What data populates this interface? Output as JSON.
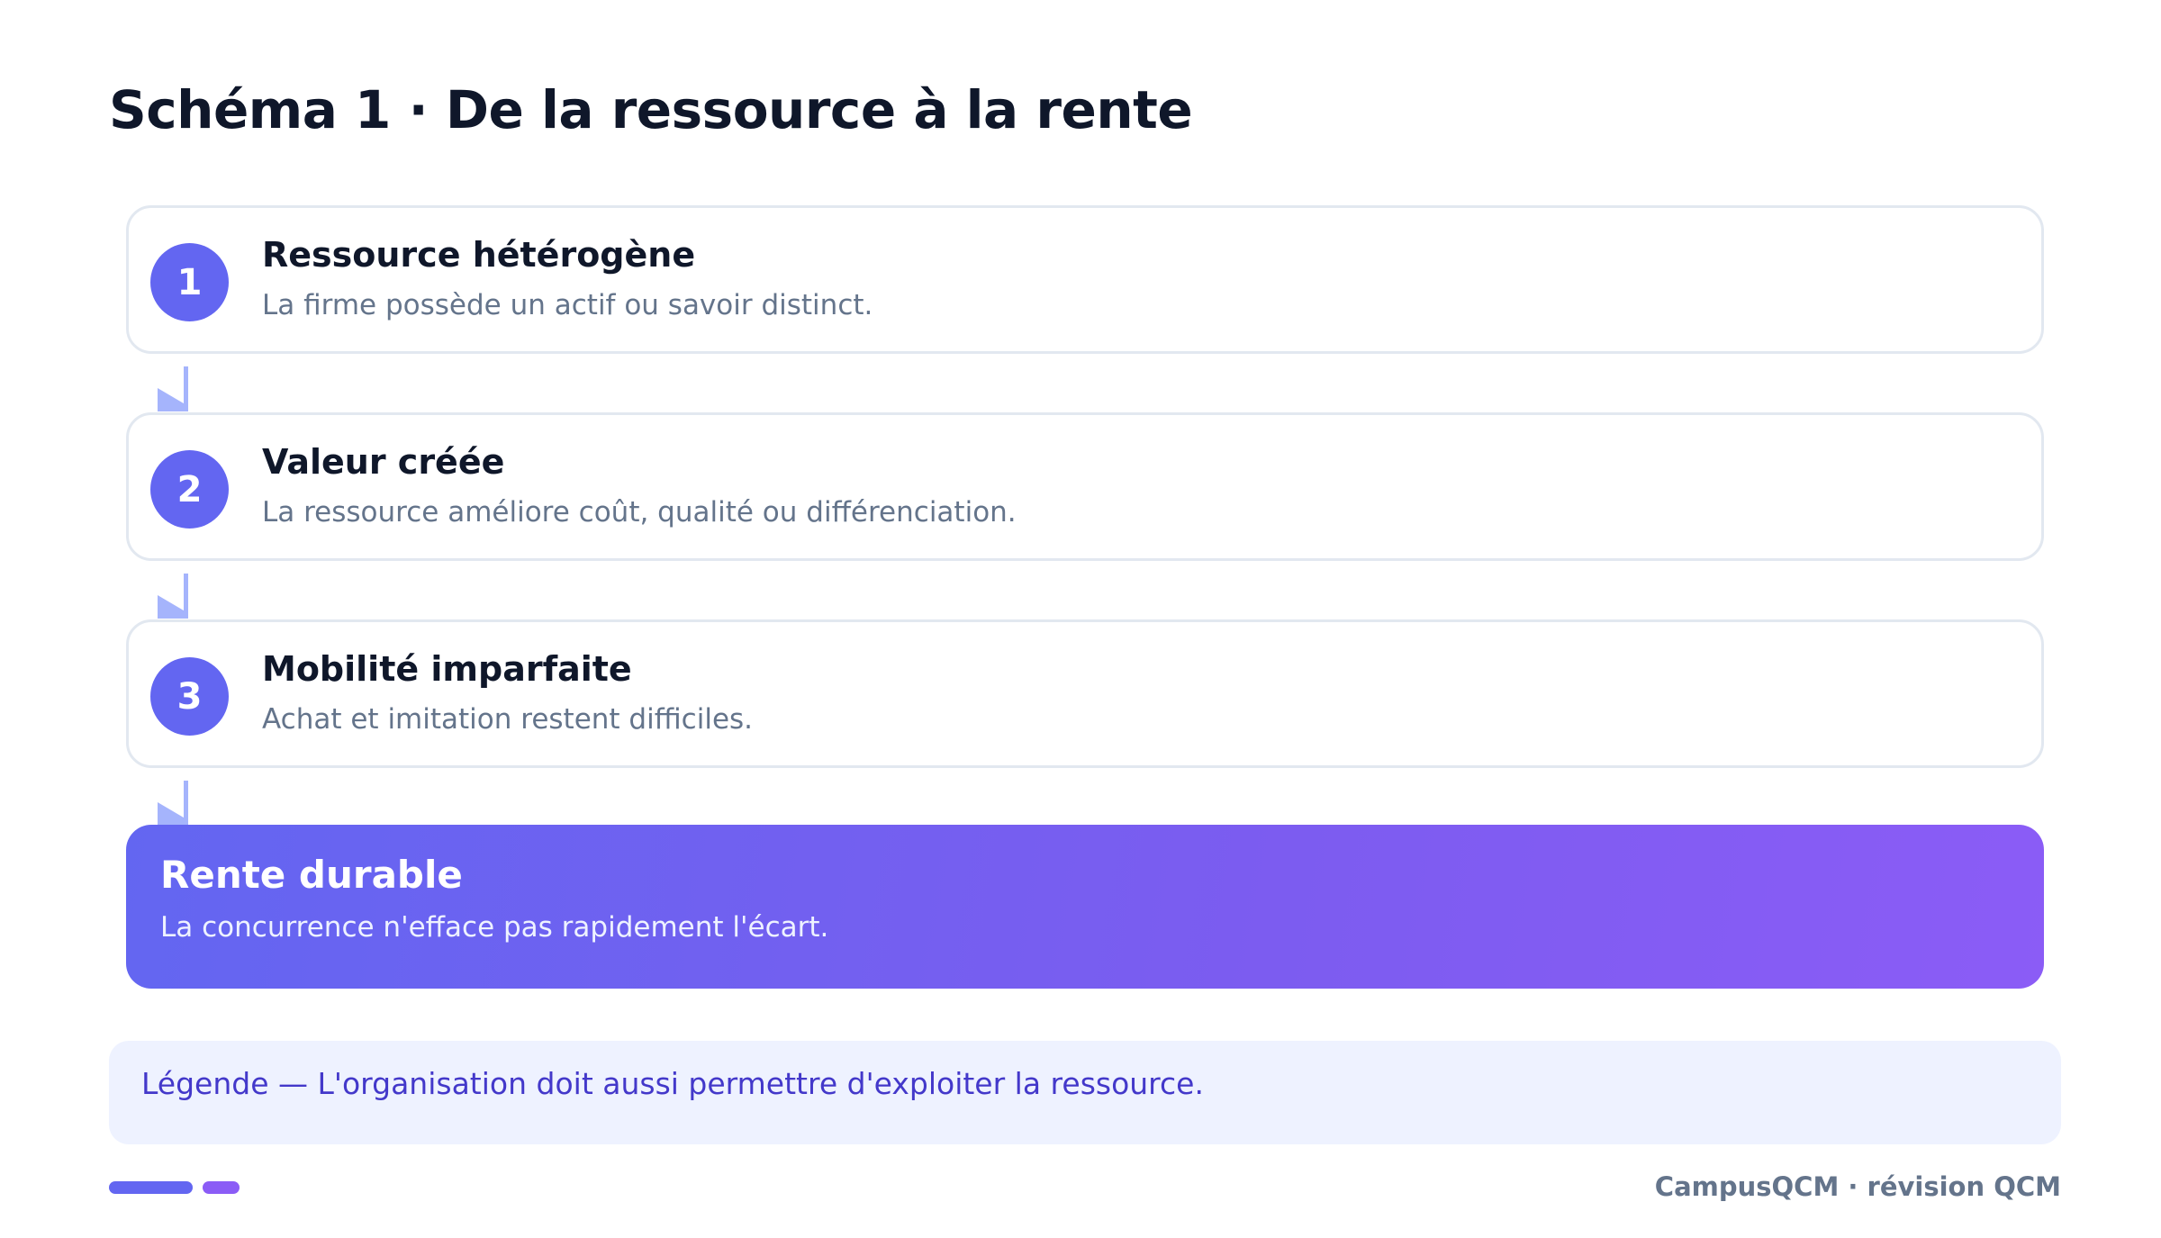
{
  "title": "Schéma 1 · De la ressource à la rente",
  "steps": [
    {
      "number": "1",
      "title": "Ressource hétérogène",
      "description": "La firme possède un actif ou savoir distinct."
    },
    {
      "number": "2",
      "title": "Valeur créée",
      "description": "La ressource améliore coût, qualité ou différenciation."
    },
    {
      "number": "3",
      "title": "Mobilité imparfaite",
      "description": "Achat et imitation restent difficiles."
    }
  ],
  "outcome": {
    "title": "Rente durable",
    "description": "La concurrence n'efface pas rapidement l'écart."
  },
  "legend": "Légende — L'organisation doit aussi permettre d'exploiter la ressource.",
  "footer": {
    "brand": "CampusQCM · révision QCM"
  },
  "colors": {
    "accent": "#6366f1",
    "accent_secondary": "#8b5cf6",
    "connector": "#a5b4fc",
    "card_border": "#e2e8f0",
    "legend_bg": "#eef2ff",
    "legend_text": "#4338ca"
  }
}
